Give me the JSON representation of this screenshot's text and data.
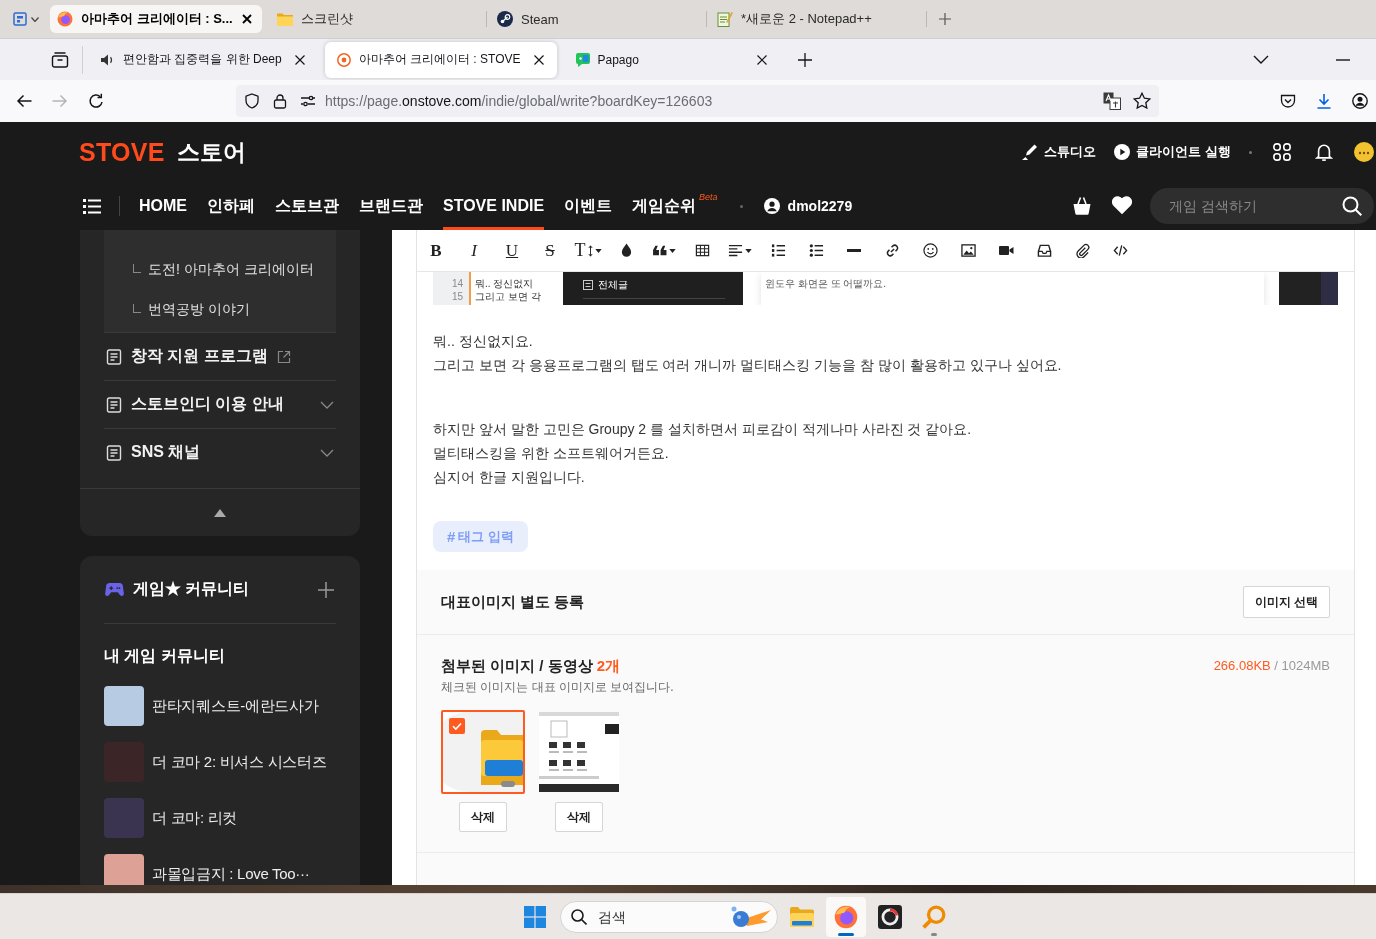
{
  "browser_groups": {
    "tabs": [
      {
        "kind": "firefox",
        "title": "아마추어 크리에이터 : S...",
        "selected": true
      },
      {
        "kind": "folder",
        "title": "스크린샷",
        "selected": false
      },
      {
        "kind": "steam",
        "title": "Steam",
        "selected": false
      },
      {
        "kind": "notepad",
        "title": "*새로운 2 - Notepad++",
        "selected": false
      }
    ]
  },
  "tab_strip": {
    "tabs": [
      {
        "kind": "audio",
        "title": "편안함과 집중력을 위한 Deep",
        "selected": false
      },
      {
        "kind": "stove",
        "title": "아마추어 크리에이터 : STOVE",
        "selected": true
      },
      {
        "kind": "papago",
        "title": "Papago",
        "selected": false
      }
    ]
  },
  "toolbar": {
    "forward_disabled": true,
    "url_parts": [
      {
        "text": "https://page.",
        "highlighted": false
      },
      {
        "text": "onstove.com",
        "highlighted": true
      },
      {
        "text": "/indie/global/write?boardKey=126603",
        "highlighted": false
      }
    ]
  },
  "site_header": {
    "logo": "STOVE",
    "logo_suffix": "스토어",
    "links": [
      {
        "kind": "studio",
        "label": "스튜디오"
      },
      {
        "kind": "client",
        "label": "클라이언트 실행"
      }
    ],
    "nav": [
      {
        "label": "HOME",
        "selected": false
      },
      {
        "label": "인하페",
        "selected": false
      },
      {
        "label": "스토브관",
        "selected": false
      },
      {
        "label": "브랜드관",
        "selected": false
      },
      {
        "label": "STOVE INDIE",
        "selected": true
      },
      {
        "label": "이벤트",
        "selected": false
      },
      {
        "label": "게임순위",
        "selected": false,
        "badge": "Beta"
      }
    ],
    "username": "dmol2279",
    "search": {
      "placeholder": "게임 검색하기"
    }
  },
  "sidebar": {
    "sub_items": [
      {
        "label": "도전! 아마추어 크리에이터"
      },
      {
        "label": "번역공방 이야기"
      }
    ],
    "menu": [
      {
        "label": "창작 지원 프로그램",
        "kind": "external"
      },
      {
        "label": "스토브인디 이용 안내",
        "kind": "dropdown"
      },
      {
        "label": "SNS 채널",
        "kind": "dropdown"
      }
    ]
  },
  "community": {
    "title": "게임★ 커뮤니티",
    "subtitle": "내 게임 커뮤니티",
    "games": [
      {
        "name": "판타지퀘스트-에란드사가",
        "color": "#b7cbe2"
      },
      {
        "name": "더 코마 2: 비셔스 시스터즈",
        "color": "#3b2526"
      },
      {
        "name": "더 코마: 리컷",
        "color": "#3a3450"
      },
      {
        "name": "과몰입금지 : Love Too···",
        "color": "#dea196"
      }
    ]
  },
  "editor": {
    "toolbar": [
      {
        "kind": "bold",
        "label": "B",
        "dropdown": false
      },
      {
        "kind": "italic",
        "label": "I",
        "dropdown": false
      },
      {
        "kind": "underline",
        "label": "U",
        "dropdown": false
      },
      {
        "kind": "strike",
        "label": "S",
        "dropdown": false
      },
      {
        "kind": "font_size",
        "label": "T",
        "dropdown": true
      },
      {
        "kind": "color",
        "dropdown": false
      },
      {
        "kind": "quote",
        "dropdown": true
      },
      {
        "kind": "table",
        "dropdown": false
      },
      {
        "kind": "align",
        "dropdown": true
      },
      {
        "kind": "ordered_list",
        "dropdown": false
      },
      {
        "kind": "bullet_list",
        "dropdown": false
      },
      {
        "kind": "rule",
        "dropdown": false
      },
      {
        "kind": "link",
        "dropdown": false
      },
      {
        "kind": "emoji",
        "dropdown": false
      },
      {
        "kind": "image",
        "dropdown": false
      },
      {
        "kind": "video",
        "dropdown": false
      },
      {
        "kind": "tray",
        "dropdown": false
      },
      {
        "kind": "attachment",
        "dropdown": false
      },
      {
        "kind": "code",
        "dropdown": false
      }
    ],
    "embedded_screenshot": {
      "line_numbers": [
        "14",
        "15"
      ],
      "lines": [
        "뭐.. 정신없지",
        "그리고 보면 각"
      ],
      "menu_item": "전체글",
      "caption": "윈도우 화면은 또 어떨까요."
    },
    "paragraphs": [
      {
        "lines": [
          "뭐.. 정신없지요.",
          "그리고 보면 각 응용프로그램의 탭도 여러 개니까 멀티태스킹 기능을 참 많이 활용하고 있구나 싶어요."
        ]
      },
      {
        "lines": [
          "하지만 앞서 말한 고민은 Groupy 2 를 설치하면서 피로감이 적게나마 사라진 것 같아요.",
          "멀티태스킹을 위한 소프트웨어거든요.",
          "심지어 한글 지원입니다."
        ]
      }
    ],
    "tag_button": {
      "symbol": "#",
      "label": "태그 입력"
    }
  },
  "cover_image": {
    "title": "대표이미지 별도 등록",
    "button": "이미지 선택"
  },
  "attachments": {
    "title": "첨부된 이미지 / 동영상",
    "count": "2개",
    "size_used": "266.08KB",
    "size_limit": "/ 1024MB",
    "note": "체크된 이미지는 대표 이미지로 보여집니다.",
    "items": [
      {
        "kind": "folder",
        "checked": true,
        "delete_label": "삭제"
      },
      {
        "kind": "screenshot",
        "checked": false,
        "delete_label": "삭제"
      }
    ]
  },
  "taskbar": {
    "search": {
      "placeholder": "검색"
    },
    "apps": [
      {
        "kind": "explorer",
        "open": false,
        "focused": false
      },
      {
        "kind": "firefox",
        "open": true,
        "focused": true
      },
      {
        "kind": "ring_app",
        "open": false,
        "focused": false
      },
      {
        "kind": "magnifier",
        "open": true,
        "focused": false
      }
    ]
  }
}
